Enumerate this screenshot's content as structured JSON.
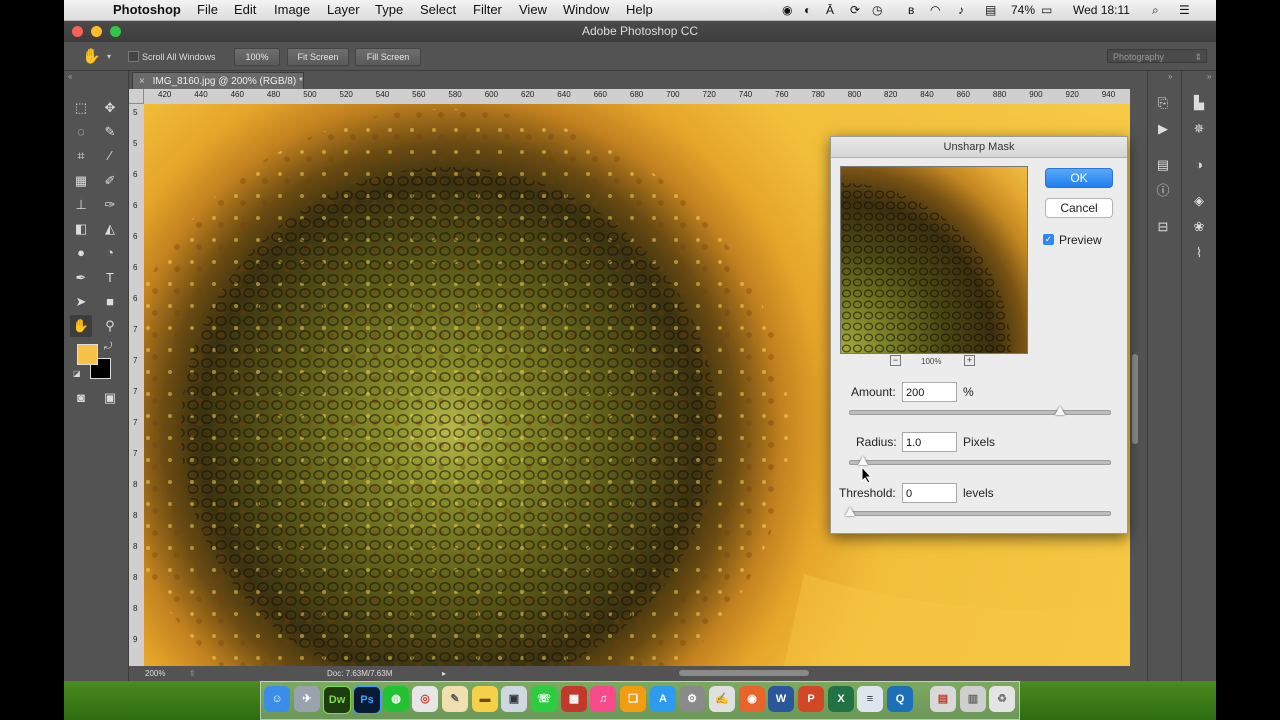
{
  "menubar": {
    "app_name": "Photoshop",
    "menus": [
      "File",
      "Edit",
      "Image",
      "Layer",
      "Type",
      "Select",
      "Filter",
      "View",
      "Window",
      "Help"
    ],
    "battery": "74%",
    "clock": "Wed 18:11"
  },
  "window": {
    "title": "Adobe Photoshop CC"
  },
  "options_bar": {
    "scroll_all_windows": "Scroll All Windows",
    "zoom_btn": "100%",
    "fit_screen": "Fit Screen",
    "fill_screen": "Fill Screen",
    "workspace": "Photography"
  },
  "document": {
    "tab_title": "IMG_8160.jpg @ 200% (RGB/8) *",
    "ruler_h": [
      "420",
      "440",
      "460",
      "480",
      "500",
      "520",
      "540",
      "560",
      "580",
      "600",
      "620",
      "640",
      "660",
      "680",
      "700",
      "720",
      "740",
      "760",
      "780",
      "800",
      "820",
      "840",
      "860",
      "880",
      "900",
      "920",
      "940"
    ],
    "ruler_v": [
      "5",
      "5",
      "6",
      "6",
      "6",
      "6",
      "6",
      "7",
      "7",
      "7",
      "7",
      "7",
      "8",
      "8",
      "8",
      "8",
      "8",
      "9"
    ],
    "zoom_status": "200%",
    "doc_size": "Doc: 7.63M/7.63M"
  },
  "colors": {
    "foreground": "#f6c24a",
    "background": "#000000"
  },
  "dialog": {
    "title": "Unsharp Mask",
    "ok": "OK",
    "cancel": "Cancel",
    "preview_label": "Preview",
    "preview_checked": true,
    "preview_zoom": "100%",
    "amount_label": "Amount:",
    "amount_value": "200",
    "amount_unit": "%",
    "radius_label": "Radius:",
    "radius_value": "1.0",
    "radius_unit": "Pixels",
    "threshold_label": "Threshold:",
    "threshold_value": "0",
    "threshold_unit": "levels",
    "amount_slider_level": 0.82,
    "radius_slider_level": 0.05,
    "threshold_slider_level": 0.0
  },
  "tools": [
    "marquee-icon",
    "move-icon",
    "lasso-icon",
    "quick-select-icon",
    "crop-icon",
    "eyedropper-icon",
    "healing-icon",
    "brush-icon",
    "stamp-icon",
    "history-brush-icon",
    "eraser-icon",
    "bucket-icon",
    "blur-icon",
    "dodge-icon",
    "pen-icon",
    "type-icon",
    "path-select-icon",
    "rectangle-icon",
    "hand-icon",
    "zoom-icon"
  ]
}
